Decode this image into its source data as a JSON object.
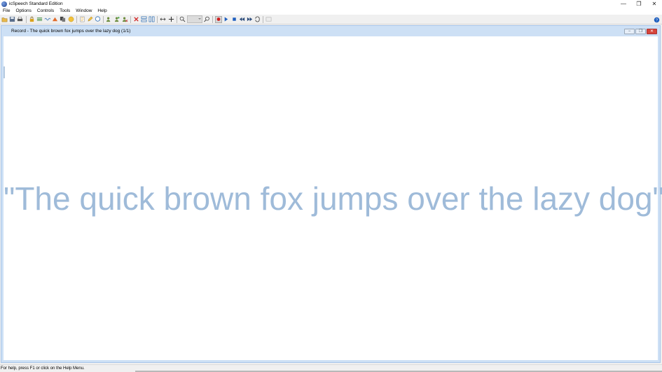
{
  "window": {
    "title": "icSpeech Standard Edition",
    "minimize_glyph": "—",
    "restore_glyph": "❐",
    "close_glyph": "✕"
  },
  "menu": {
    "items": [
      {
        "label": "File"
      },
      {
        "label": "Options"
      },
      {
        "label": "Controls"
      },
      {
        "label": "Tools"
      },
      {
        "label": "Window"
      },
      {
        "label": "Help"
      }
    ]
  },
  "toolbar": {
    "icons": [
      "open-folder-icon",
      "save-icon",
      "print-icon",
      "lock-icon",
      "align-icon",
      "wave-icon",
      "triangle-icon",
      "copy-icon",
      "face-icon",
      "document-icon",
      "edit-icon",
      "chat-icon",
      "people-icon",
      "people-add-icon",
      "people-remove-icon",
      "delete-icon",
      "split-icon",
      "columns-icon",
      "horizontal-arrows-icon",
      "move-icon",
      "zoom-in-icon",
      "zoom-out-icon",
      "record-icon",
      "play-icon",
      "stop-icon",
      "rewind-icon",
      "fast-forward-icon",
      "loop-icon",
      "export-icon",
      "help-icon"
    ],
    "record_color": "#d02020",
    "play_color": "#1f5fbf"
  },
  "document": {
    "title": "Record - The quick brown fox jumps over the lazy dog (1/1)",
    "speech_text": "\"The quick brown fox jumps over the lazy dog\"",
    "text_color": "#9fbbd9"
  },
  "status": {
    "text": "For help, press F1 or click on the Help Menu."
  }
}
